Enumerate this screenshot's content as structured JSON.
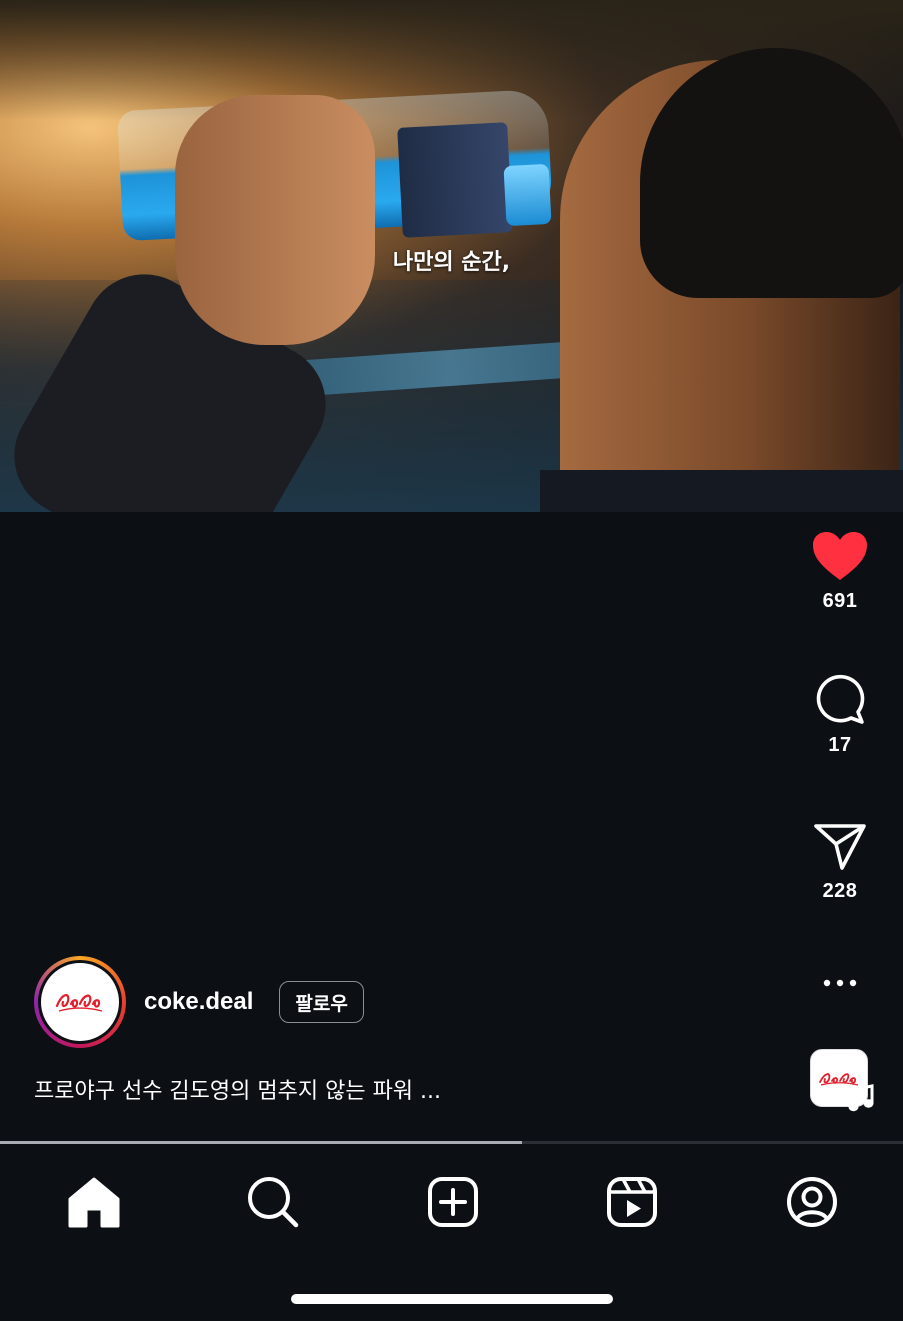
{
  "video": {
    "subtitle": "나만의 순간,",
    "progress_fraction": 0.578
  },
  "actions": {
    "like": {
      "icon": "heart-filled-icon",
      "count": "691",
      "color": "#ff3040"
    },
    "comment": {
      "icon": "comment-bubble-icon",
      "count": "17"
    },
    "share": {
      "icon": "paper-plane-icon",
      "count": "228"
    },
    "more": {
      "icon": "more-dots-icon"
    },
    "audio": {
      "icon": "music-note-icon"
    }
  },
  "post": {
    "username": "coke.deal",
    "follow_label": "팔로우",
    "caption": "프로야구 선수 김도영의 멈추지 않는 파워 ...",
    "avatar_brand": "Coca-Cola",
    "brand_color": "#e41e2b"
  },
  "nav": {
    "items": [
      {
        "icon": "home-icon",
        "active": true
      },
      {
        "icon": "search-icon",
        "active": false
      },
      {
        "icon": "create-post-icon",
        "active": false
      },
      {
        "icon": "reels-icon",
        "active": false
      },
      {
        "icon": "profile-icon",
        "active": false
      }
    ]
  }
}
